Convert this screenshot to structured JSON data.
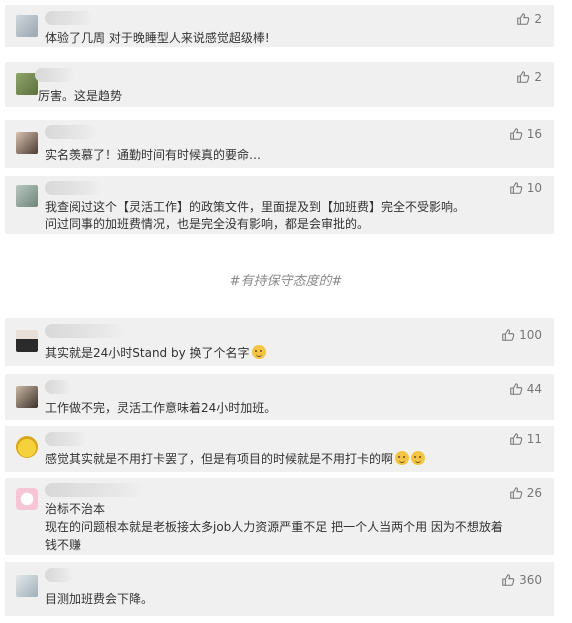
{
  "comments": [
    {
      "text": "体验了几周 对于晚睡型人来说感觉超级棒!",
      "likes": "2"
    },
    {
      "text": "厉害。这是趋势",
      "likes": "2"
    },
    {
      "text": "实名羡慕了！通勤时间有时候真的要命…",
      "likes": "16"
    },
    {
      "text_line1": "我查阅过这个【灵活工作】的政策文件，里面提及到【加班费】完全不受影响。",
      "text_line2": "问过同事的加班费情况，也是完全没有影响，都是会审批的。",
      "likes": "10"
    }
  ],
  "section_heading": "#有持保守态度的#",
  "comments2": [
    {
      "text": "其实就是24小时Stand by 换了个名字",
      "likes": "100",
      "emoji": "smile-emoji"
    },
    {
      "text": "工作做不完，灵活工作意味着24小时加班。",
      "likes": "44"
    },
    {
      "text": "感觉其实就是不用打卡罢了，但是有项目的时候就是不用打卡的啊",
      "likes": "11",
      "emoji": "cry-laugh-emoji"
    },
    {
      "text_line1": "治标不治本",
      "text_line2": "现在的问题根本就是老板接太多job人力资源严重不足 把一个人当两个用 因为不想放着",
      "text_line3": "钱不赚",
      "likes": "26"
    },
    {
      "text": "目测加班费会下降。",
      "likes": "360"
    }
  ],
  "icons": {
    "like": "thumbs-up-icon"
  },
  "colors": {
    "card_bg": "#f0f0f0",
    "text": "#333333",
    "meta": "#777777"
  }
}
